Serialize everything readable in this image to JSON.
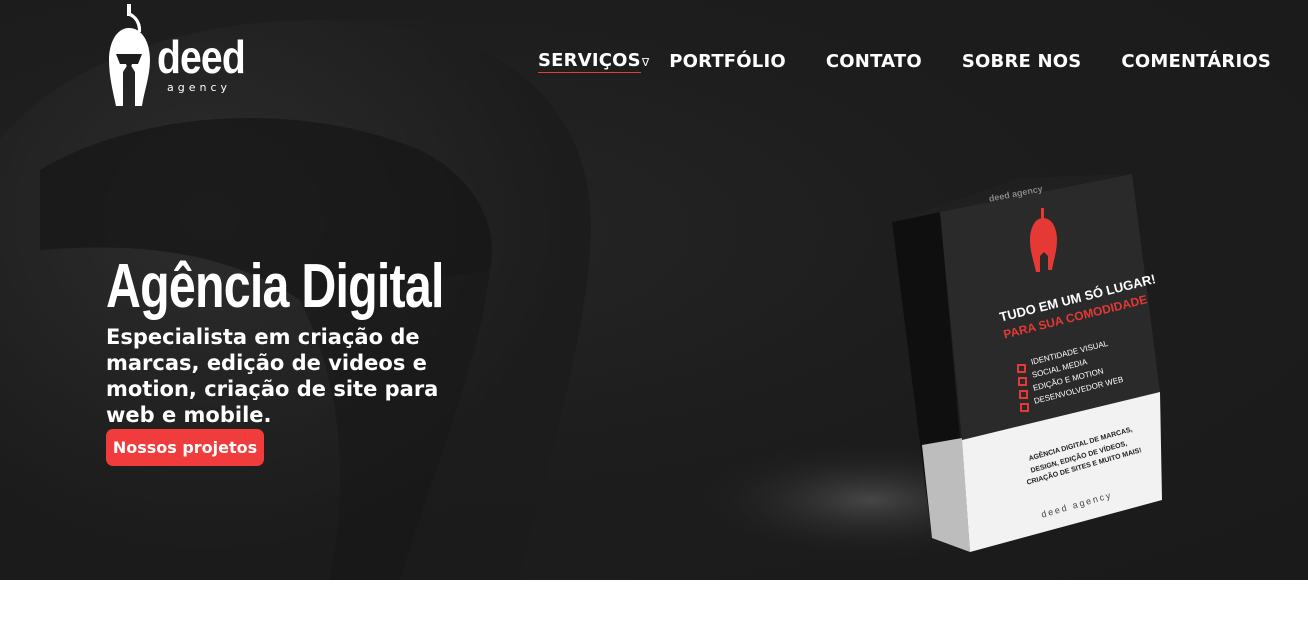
{
  "brand": {
    "name": "deed",
    "tagline": "agency"
  },
  "nav": {
    "items": [
      {
        "label": "SERVIÇOS",
        "has_dropdown": true,
        "caret": "∇",
        "active": true
      },
      {
        "label": "PORTFÓLIO"
      },
      {
        "label": "CONTATO"
      },
      {
        "label": "SOBRE NOS"
      },
      {
        "label": "COMENTÁRIOS"
      }
    ]
  },
  "hero": {
    "title": "Agência Digital",
    "subtitle": "Especialista em criação de marcas, edição de videos e motion, criação de site para web e mobile.",
    "cta_label": "Nossos projetos"
  },
  "product_box": {
    "top_label": "deed agency",
    "headline_1": "TUDO EM UM SÓ LUGAR!",
    "headline_2": "PARA SUA COMODIDADE",
    "checklist": [
      "IDENTIDADE VISUAL",
      "SOCIAL MEDIA",
      "EDIÇÃO E MOTION",
      "DESENVOLVEDOR WEB"
    ],
    "bottom_lines": [
      "AGÊNCIA DIGITAL DE MARCAS,",
      "DESIGN, EDIÇÃO DE VÍDEOS,",
      "CRIAÇÃO DE SITES E MUITO MAIS!"
    ],
    "footer": "deed agency"
  },
  "colors": {
    "accent": "#f03c3c",
    "hero_bg": "#1d1d1d",
    "text": "#ffffff"
  }
}
